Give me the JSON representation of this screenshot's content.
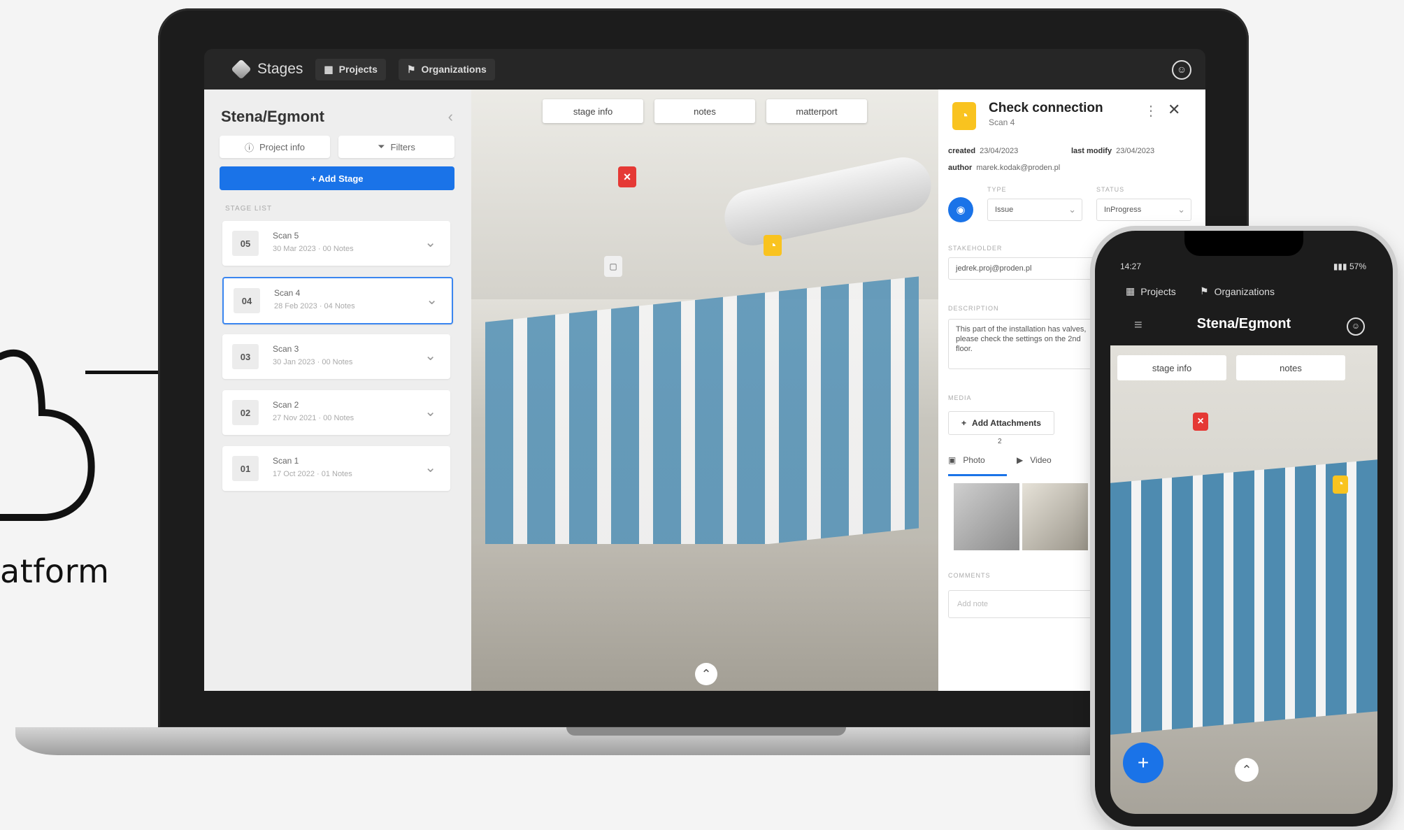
{
  "left_caption": "atform",
  "laptop": {
    "header": {
      "brand": "Stages",
      "nav": [
        {
          "label": "Projects",
          "icon": "grid-icon"
        },
        {
          "label": "Organizations",
          "icon": "flag-icon"
        }
      ],
      "user_icon": "user-circle-icon"
    },
    "sidebar": {
      "title": "Stena/Egmont",
      "project_info_label": "Project info",
      "filters_label": "Filters",
      "add_stage_label": "+  Add Stage",
      "section_label": "STAGE LIST",
      "stages": [
        {
          "num": "05",
          "name": "Scan 5",
          "meta": "30 Mar 2023 · 00 Notes"
        },
        {
          "num": "04",
          "name": "Scan 4",
          "meta": "28 Feb 2023 · 04 Notes"
        },
        {
          "num": "03",
          "name": "Scan 3",
          "meta": "30 Jan 2023 · 00 Notes"
        },
        {
          "num": "02",
          "name": "Scan 2",
          "meta": "27 Nov 2021 · 00 Notes"
        },
        {
          "num": "01",
          "name": "Scan 1",
          "meta": "17 Oct 2022 · 01 Notes"
        }
      ]
    },
    "viewer": {
      "tabs": [
        "stage info",
        "notes",
        "matterport"
      ]
    },
    "panel": {
      "title": "Check connection",
      "subtitle": "Scan 4",
      "created_label": "created",
      "created_value": "23/04/2023",
      "modified_label": "last modify",
      "modified_value": "23/04/2023",
      "author_label": "author",
      "author_value": "marek.kodak@proden.pl",
      "type_label": "TYPE",
      "type_value": "Issue",
      "status_label": "STATUS",
      "status_value": "InProgress",
      "stakeholder_label": "STAKEHOLDER",
      "stakeholder_value": "jedrek.proj@proden.pl",
      "description_label": "DESCRIPTION",
      "description_value": "This part of the installation has valves, please check the settings on the 2nd floor.",
      "media_label": "MEDIA",
      "add_attachments_label": "Add Attachments",
      "photos_label": "Photo",
      "photos_count": "2",
      "video_label": "Video",
      "comments_label": "COMMENTS",
      "comment_placeholder": "Add note"
    }
  },
  "phone": {
    "time": "14:27",
    "battery": "57%",
    "nav": [
      {
        "label": "Projects",
        "icon": "grid-icon"
      },
      {
        "label": "Organizations",
        "icon": "flag-icon"
      }
    ],
    "title": "Stena/Egmont",
    "tabs": [
      "stage info",
      "notes"
    ]
  },
  "colors": {
    "accent": "#1a73e8",
    "note_yellow": "#f9c31f",
    "issue_red": "#e53935"
  }
}
